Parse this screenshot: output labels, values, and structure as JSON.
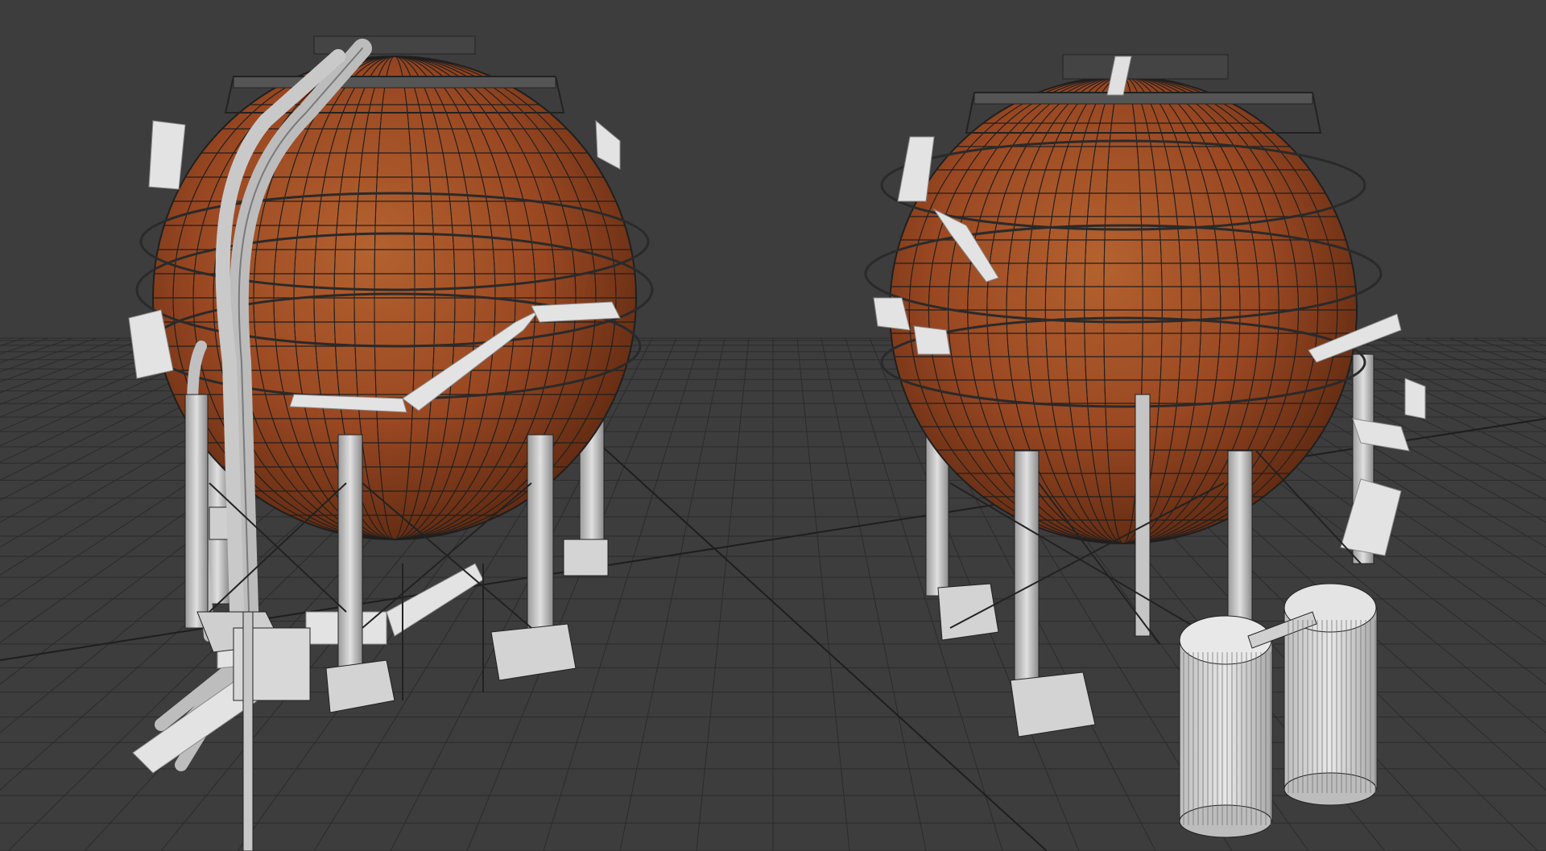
{
  "viewport": {
    "background_color": "#3d3d3d",
    "grid_color": "#2b2b2b",
    "grid_axis_color": "#1e1e1e"
  },
  "models": [
    {
      "name": "spherical-tank-left",
      "shell_color": "#a2502a",
      "wire_color": "#1f1f1f",
      "structure_color": "#d9d9d9"
    },
    {
      "name": "spherical-tank-right",
      "shell_color": "#a2502a",
      "wire_color": "#1f1f1f",
      "structure_color": "#d9d9d9"
    }
  ]
}
